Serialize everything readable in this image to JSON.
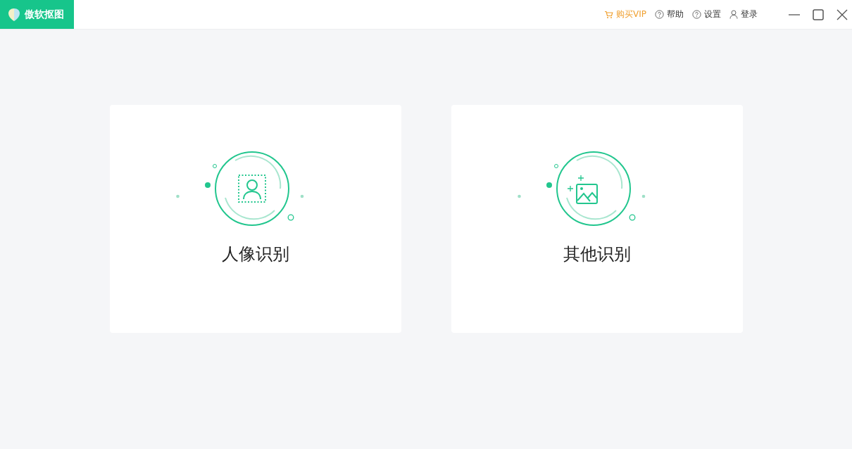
{
  "app": {
    "name": "傲软抠图"
  },
  "header_links": [
    {
      "kind": "vip",
      "label": "购买VIP"
    },
    {
      "kind": "help",
      "label": "帮助"
    },
    {
      "kind": "settings",
      "label": "设置"
    },
    {
      "kind": "login",
      "label": "登录"
    }
  ],
  "cards": [
    {
      "kind": "portrait",
      "label": "人像识别"
    },
    {
      "kind": "image",
      "label": "其他识别"
    }
  ]
}
